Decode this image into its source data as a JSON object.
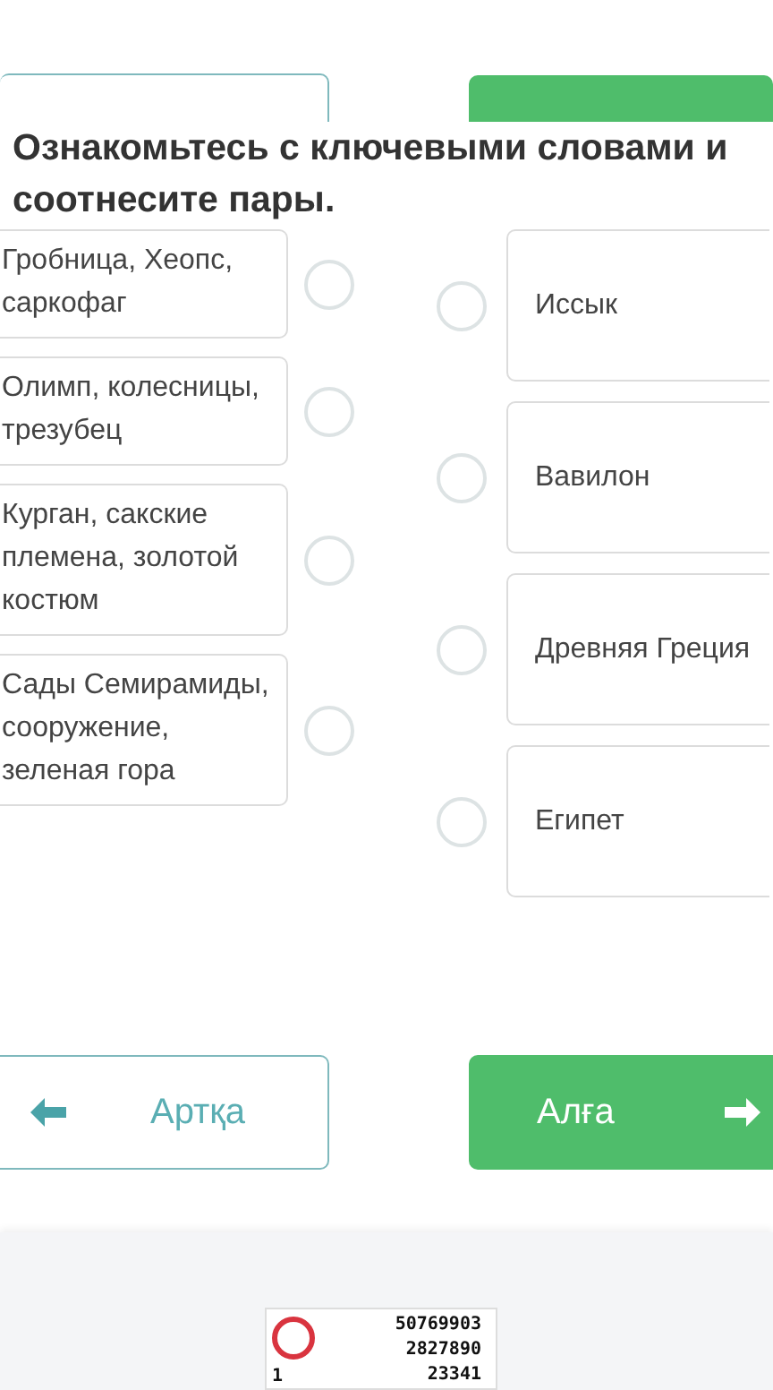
{
  "title": "Ознакомьтесь с ключевыми словами и соотнесите пары.",
  "left_items": [
    {
      "text": "Гробница, Хеопс, саркофаг",
      "selected": false
    },
    {
      "text": "Олимп, колесницы, трезубец",
      "selected": false
    },
    {
      "text": "Курган, сакские племена, золотой костюм",
      "selected": false
    },
    {
      "text": "Сады Семирамиды, сооружение, зеленая гора",
      "selected": false
    }
  ],
  "right_items": [
    {
      "text": "Иссык",
      "selected": false
    },
    {
      "text": "Вавилон",
      "selected": false
    },
    {
      "text": "Древняя Греция",
      "selected": false
    },
    {
      "text": "Египет",
      "selected": false
    }
  ],
  "nav": {
    "back": "Артқа",
    "next": "Алға"
  },
  "counter": {
    "lines": [
      "50769903",
      "2827890",
      "23341"
    ],
    "index": "1"
  }
}
